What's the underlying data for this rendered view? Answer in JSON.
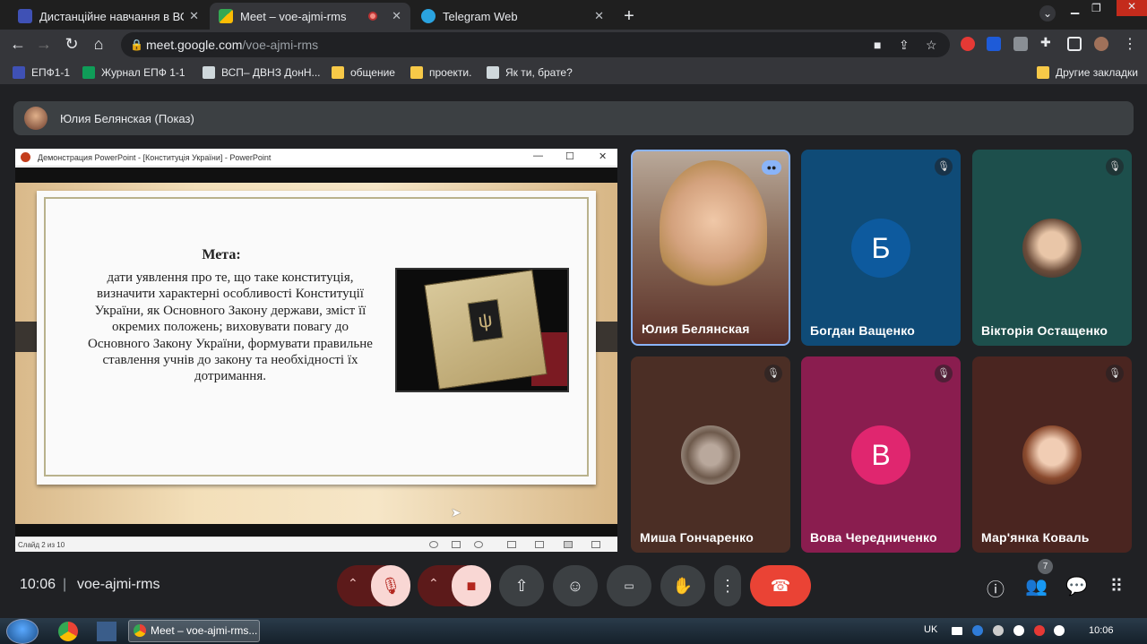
{
  "browser": {
    "tabs": [
      {
        "title": "Дистанційне навчання в ВСП",
        "close": "✕"
      },
      {
        "title": "Meet – voe-ajmi-rms",
        "close": "✕"
      },
      {
        "title": "Telegram Web",
        "close": "✕"
      }
    ],
    "new_tab": "+",
    "url_host": "meet.google.com",
    "url_path": "/voe-ajmi-rms",
    "bookmarks": [
      "ЕПФ1-1",
      "Журнал ЕПФ 1-1",
      "ВСП– ДВНЗ ДонН...",
      "общение",
      "проекти.",
      "Як ти, брате?"
    ],
    "other_bookmarks": "Другие закладки"
  },
  "meet": {
    "presenting_label": "Юлия Белянская (Показ)",
    "clock": "10:06",
    "separator": "|",
    "meeting_code": "voe-ajmi-rms",
    "people_count": "7",
    "participants": [
      {
        "name": "Юлия Белянская",
        "muted": false,
        "speaking": true
      },
      {
        "name": "Богдан Ващенко",
        "initial": "Б",
        "muted": true
      },
      {
        "name": "Вікторія Остащенко",
        "muted": true
      },
      {
        "name": "Миша Гончаренко",
        "muted": true
      },
      {
        "name": "Вова Чередниченко",
        "initial": "В",
        "muted": true
      },
      {
        "name": "Мар'янка Коваль",
        "muted": true
      }
    ],
    "colors": {
      "end_call": "#ea4335",
      "speaking_border": "#8ab4f8",
      "muted_ctrl": "#f9d7d4"
    }
  },
  "slide": {
    "window_title": "Демонстрация PowerPoint - [Конституція України] - PowerPoint",
    "heading": "Мета:",
    "body": "дати уявлення про те, що таке конституція, визначити характерні особливості Конституції України, як Основного Закону держави, зміст її окремих положень; виховувати повагу до Основного Закону України, формувати правильне ставлення учнів до закону та необхідності їх дотримання.",
    "status": "Слайд 2 из 10"
  },
  "taskbar": {
    "task_label": "Meet – voe-ajmi-rms...",
    "lang": "UK",
    "time": "10:06"
  }
}
